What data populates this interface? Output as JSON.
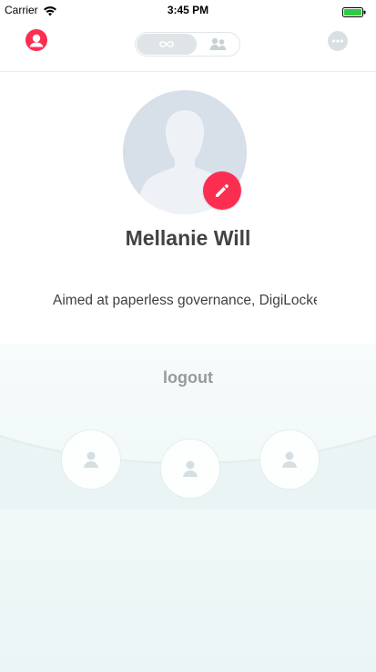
{
  "status_bar": {
    "carrier": "Carrier",
    "time": "3:45 PM",
    "battery_color": "#2ecc40"
  },
  "nav": {
    "profile_icon": "user-circle-icon",
    "segment_left_icon": "infinity-icon",
    "segment_right_icon": "group-icon",
    "chat_icon": "chat-bubble-icon",
    "accent_color": "#fb2e52"
  },
  "profile": {
    "name": "Mellanie Will",
    "bio": "Aimed at paperless governance, DigiLocker",
    "edit_icon": "pencil-icon"
  },
  "bottom": {
    "logout_label": "logout",
    "friends": [
      "user-icon",
      "user-icon",
      "user-icon"
    ]
  }
}
